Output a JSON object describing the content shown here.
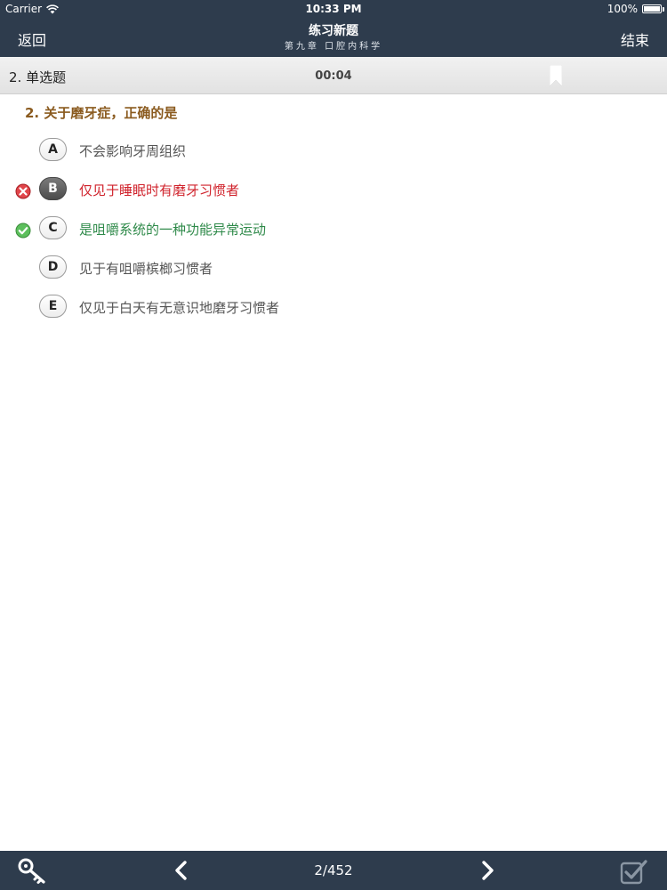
{
  "status_bar": {
    "carrier": "Carrier",
    "time": "10:33 PM",
    "battery": "100%"
  },
  "nav": {
    "back_label": "返回",
    "title": "练习新题",
    "subtitle": "第九章 口腔内科学",
    "end_label": "结束"
  },
  "question_header": {
    "type_label": "2. 单选题",
    "timer": "00:04"
  },
  "question": {
    "stem": "2. 关于磨牙症，正确的是",
    "options": [
      {
        "letter": "A",
        "text": "不会影响牙周组织",
        "state": "normal"
      },
      {
        "letter": "B",
        "text": "仅见于睡眠时有磨牙习惯者",
        "state": "wrong-selected"
      },
      {
        "letter": "C",
        "text": "是咀嚼系统的一种功能异常运动",
        "state": "correct"
      },
      {
        "letter": "D",
        "text": "见于有咀嚼槟榔习惯者",
        "state": "normal"
      },
      {
        "letter": "E",
        "text": "仅见于白天有无意识地磨牙习惯者",
        "state": "normal"
      }
    ]
  },
  "toolbar": {
    "page_indicator": "2/452"
  },
  "icons": {
    "wifi": "wifi-icon",
    "battery": "battery-icon",
    "bookmark": "bookmark-icon",
    "wrong": "wrong-x-icon",
    "correct": "correct-check-icon",
    "key": "key-icon",
    "prev": "chevron-left-icon",
    "next": "chevron-right-icon",
    "submit": "checkbox-submit-icon"
  },
  "colors": {
    "bar_bg": "#2e3c4d",
    "question_text": "#8a5a1e",
    "wrong_text": "#d0232c",
    "correct_text": "#2f8a4a"
  }
}
